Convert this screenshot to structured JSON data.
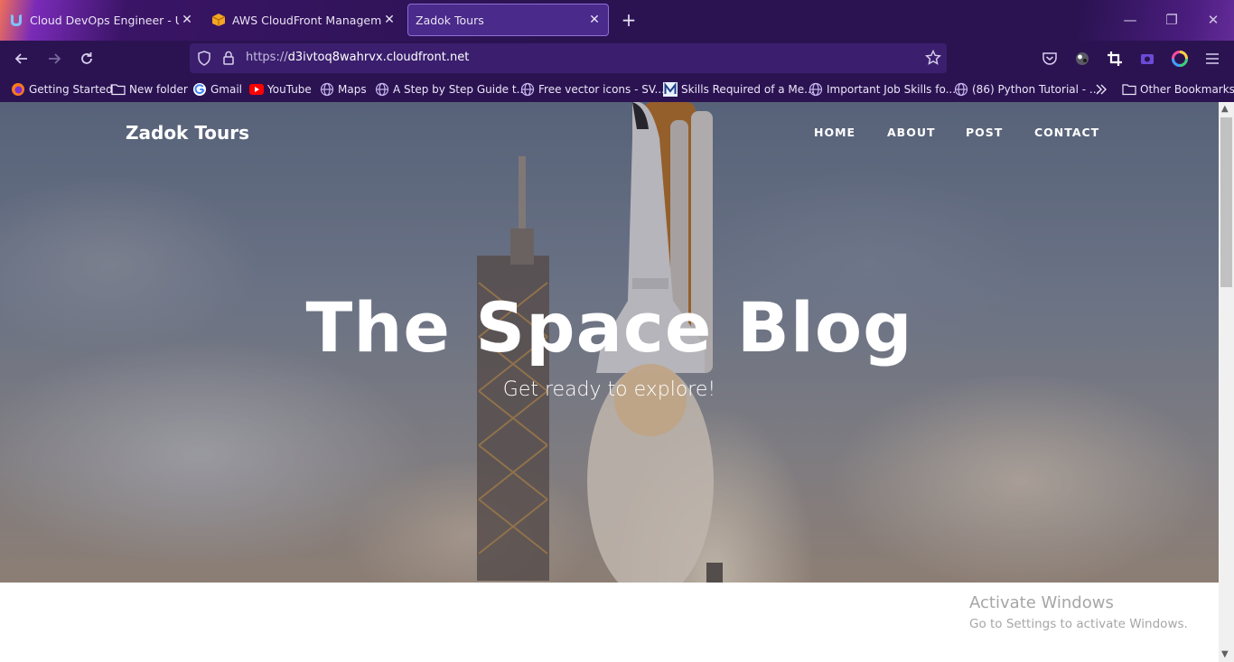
{
  "tabs": [
    {
      "title": "Cloud DevOps Engineer - Udacity",
      "favicon": "udacity-icon"
    },
    {
      "title": "AWS CloudFront Management",
      "favicon": "aws-box-icon"
    },
    {
      "title": "Zadok Tours",
      "favicon": ""
    }
  ],
  "address": {
    "prefix": "https://",
    "host": "d3ivtoq8wahrvx.cloudfront.net"
  },
  "bookmarks": [
    {
      "label": "Getting Started",
      "icon": "firefox-icon"
    },
    {
      "label": "New folder",
      "icon": "folder-icon"
    },
    {
      "label": "Gmail",
      "icon": "google-icon"
    },
    {
      "label": "YouTube",
      "icon": "youtube-icon"
    },
    {
      "label": "Maps",
      "icon": "globe-icon"
    },
    {
      "label": "A Step by Step Guide t...",
      "icon": "globe-icon"
    },
    {
      "label": "Free vector icons - SV...",
      "icon": "globe-icon"
    },
    {
      "label": "Skills Required of a Me...",
      "icon": "m-logo-icon"
    },
    {
      "label": "Important Job Skills fo...",
      "icon": "globe-icon"
    },
    {
      "label": "(86) Python Tutorial - ...",
      "icon": "globe-icon"
    },
    {
      "label": "Other Bookmarks",
      "icon": "folder-icon"
    }
  ],
  "site": {
    "brand": "Zadok Tours",
    "nav": [
      "HOME",
      "ABOUT",
      "POST",
      "CONTACT"
    ],
    "hero_title": "The Space Blog",
    "hero_subtitle": "Get ready to explore!"
  },
  "windows_notice": {
    "title": "Activate Windows",
    "subtitle": "Go to Settings to activate Windows."
  },
  "colors": {
    "chrome": "#2b1352",
    "active_tab": "#4a2a8a",
    "url_bar": "#3b1f6e"
  }
}
